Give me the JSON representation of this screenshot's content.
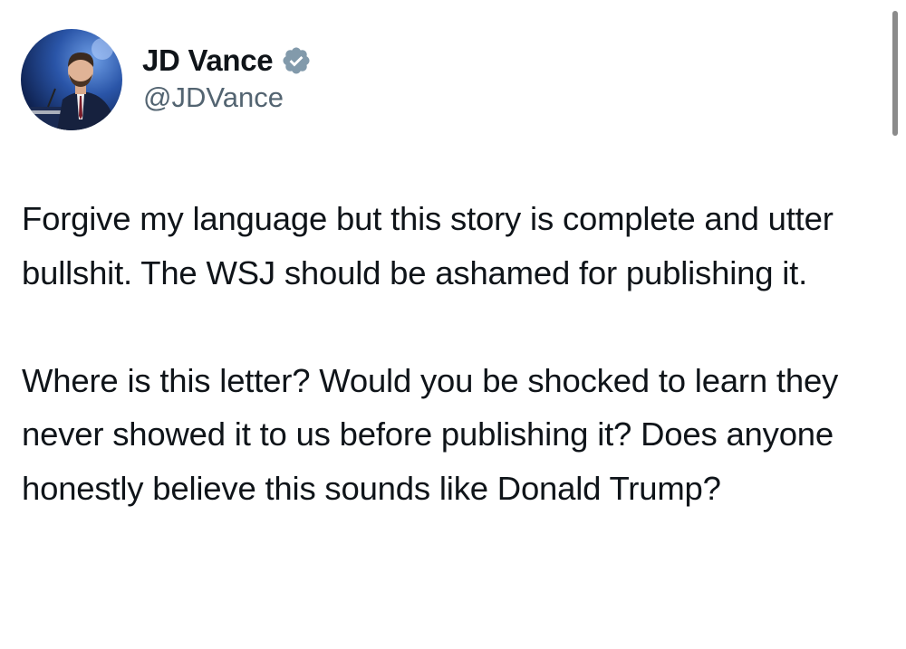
{
  "author": {
    "display_name": "JD Vance",
    "handle": "@JDVance",
    "verified": true,
    "verified_icon": "verified-badge-icon",
    "avatar_icon": "profile-photo",
    "badge_color": "#829aab"
  },
  "tweet": {
    "paragraphs": [
      "Forgive my language but this story is complete and utter bullshit. The WSJ should be ashamed for publishing it.",
      "Where is this letter? Would you be shocked to learn they never showed it to us before publishing it? Does anyone honestly believe this sounds like Donald Trump?"
    ]
  },
  "colors": {
    "text": "#0f1419",
    "handle": "#536471",
    "scrollbar": "#8b8b8b"
  }
}
